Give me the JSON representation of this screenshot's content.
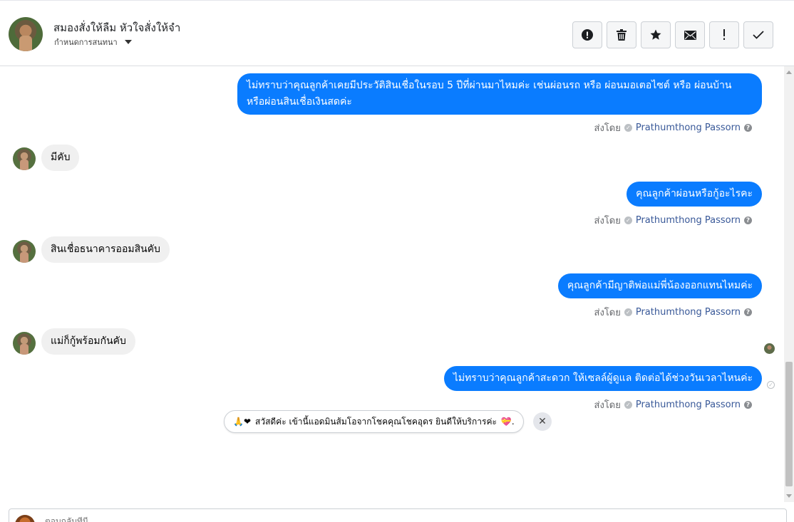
{
  "header": {
    "contact_name": "สมองสั่งให้ลืม หัวใจสั่งให้จำ",
    "assign_label": "กำหนดการสนทนา",
    "toolbar": [
      {
        "name": "spam-button",
        "icon": "alert-circle-icon"
      },
      {
        "name": "delete-button",
        "icon": "trash-icon"
      },
      {
        "name": "star-button",
        "icon": "star-icon"
      },
      {
        "name": "mark-unread-button",
        "icon": "envelope-icon"
      },
      {
        "name": "follow-up-button",
        "icon": "exclamation-icon"
      },
      {
        "name": "done-button",
        "icon": "check-icon"
      }
    ]
  },
  "messages": {
    "out1": "ไม่ทราบว่าคุณลูกค้าเคยมีประวัติสินเชื่อในรอบ 5 ปีที่ผ่านมาไหมค่ะ เช่นผ่อนรถ หรือ ผ่อนมอเตอไซต์ หรือ ผ่อนบ้าน หรือผ่อนสินเชื่อเงินสดค่ะ",
    "in1": "มีคับ",
    "out2": "คุณลูกค้าผ่อนหรือกู้อะไรคะ",
    "in2": "สินเชื่อธนาคารออมสินคับ",
    "out3": "คุณลูกค้ามีญาติพ่อแม่พี่น้องออกแทนไหมค่ะ",
    "in3": "แม่ก็กู้พร้อมกันคับ",
    "out4": "ไม่ทราบว่าคุณลูกค้าสะดวก ให้เซลล์ผู้ดูแล ติดต่อได้ช่วงวันเวลาไหนค่ะ"
  },
  "sent_by": {
    "prefix": "ส่งโดย",
    "name": "Prathumthong Passorn"
  },
  "greeting": {
    "emoji_left": "🙏❤",
    "text": "สวัสดีค่ะ เข้านี้แอดมินส้มโอจากโชคคุณโชคอุดร ยินดีให้บริการค่ะ",
    "emoji_right": "💝."
  },
  "composer": {
    "placeholder": "ตอบกลับที่นี่..."
  },
  "colors": {
    "outgoing_bubble": "#0a7cff",
    "incoming_bubble": "#f0f0f0",
    "sender_name": "#385898"
  }
}
